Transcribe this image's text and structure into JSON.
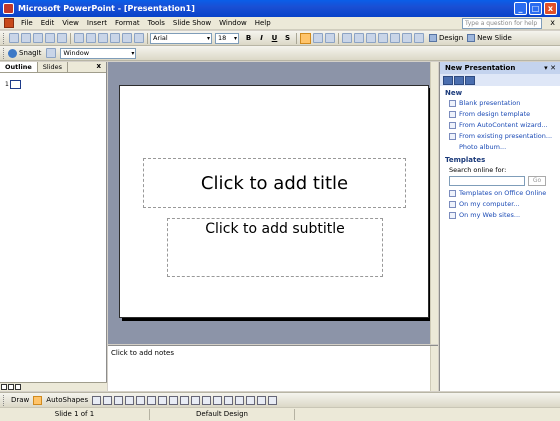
{
  "window": {
    "title": "Microsoft PowerPoint - [Presentation1]",
    "controls": [
      "_",
      "□",
      "x"
    ]
  },
  "menubar": {
    "items": [
      "File",
      "Edit",
      "View",
      "Insert",
      "Format",
      "Tools",
      "Slide Show",
      "Window",
      "Help"
    ],
    "help_placeholder": "Type a question for help",
    "close_glyph": "x"
  },
  "format_toolbar": {
    "font_name": "Arial",
    "font_size": "18",
    "bold": "B",
    "italic": "I",
    "underline": "U",
    "shadow": "S",
    "design_label": "Design",
    "new_slide_label": "New Slide"
  },
  "snagit_toolbar": {
    "snagit_label": "SnagIt",
    "capture_mode": "Window"
  },
  "outline_pane": {
    "tabs": [
      "Outline",
      "Slides"
    ],
    "close_glyph": "x",
    "slide_number": "1"
  },
  "slide": {
    "title_placeholder": "Click to add title",
    "subtitle_placeholder": "Click to add subtitle"
  },
  "notes": {
    "placeholder": "Click to add notes"
  },
  "task_pane": {
    "title": "New Presentation",
    "new_section": "New",
    "new_links": [
      "Blank presentation",
      "From design template",
      "From AutoContent wizard...",
      "From existing presentation...",
      "Photo album..."
    ],
    "templates_section": "Templates",
    "search_label": "Search online for:",
    "go_label": "Go",
    "template_links": [
      "Templates on Office Online",
      "On my computer...",
      "On my Web sites..."
    ]
  },
  "draw_toolbar": {
    "draw_label": "Draw",
    "autoshapes_label": "AutoShapes"
  },
  "statusbar": {
    "slide_info": "Slide 1 of 1",
    "design_name": "Default Design"
  }
}
